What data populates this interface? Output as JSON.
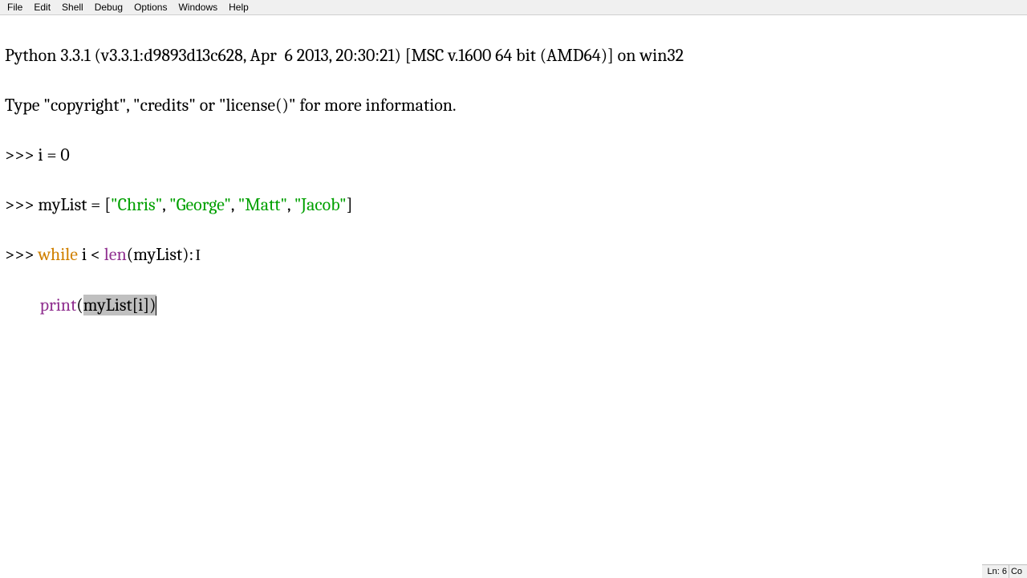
{
  "menu": {
    "file": "File",
    "edit": "Edit",
    "shell": "Shell",
    "debug": "Debug",
    "options": "Options",
    "windows": "Windows",
    "help": "Help"
  },
  "banner": {
    "line1": "Python 3.3.1 (v3.3.1:d9893d13c628, Apr  6 2013, 20:30:21) [MSC v.1600 64 bit (AMD64)] on win32",
    "line2": "Type \"copyright\", \"credits\" or \"license()\" for more information."
  },
  "code": {
    "prompt": ">>> ",
    "cont_indent": "         ",
    "l1": "i = 0",
    "l2_a": "myList = [",
    "l2_s1": "\"Chris\"",
    "l2_c": ", ",
    "l2_s2": "\"George\"",
    "l2_s3": "\"Matt\"",
    "l2_s4": "\"Jacob\"",
    "l2_z": "]",
    "l3_kw": "while",
    "l3_mid": " i < ",
    "l3_len": "len",
    "l3_end": "(myList):",
    "l4_print": "print",
    "l4_open": "(",
    "l4_sel": "myList[i])"
  },
  "status": {
    "ln": "Ln: 6",
    "co": "Co"
  }
}
